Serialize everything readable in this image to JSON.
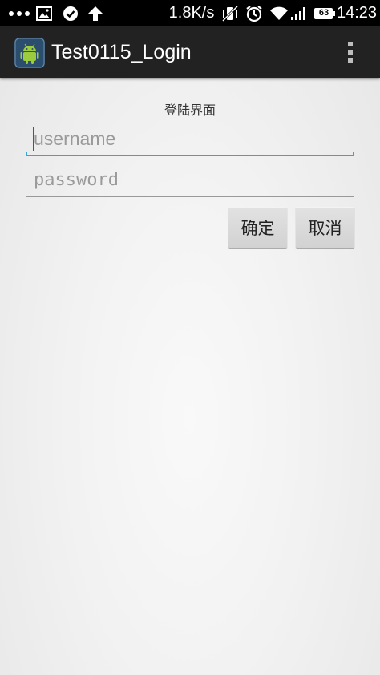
{
  "status_bar": {
    "network_speed": "1.8K/s",
    "battery_level": "63",
    "time": "14:23",
    "icons": [
      "more-dots-icon",
      "image-icon",
      "check-circle-icon",
      "upload-arrow-icon",
      "vibrate-icon",
      "alarm-icon",
      "wifi-icon",
      "signal-icon",
      "battery-icon"
    ]
  },
  "action_bar": {
    "app_title": "Test0115_Login",
    "app_icon": "android-icon",
    "menu_icon": "overflow-menu-icon"
  },
  "form": {
    "title": "登陆界面",
    "username_placeholder": "username",
    "username_value": "",
    "password_placeholder": "password",
    "password_value": "",
    "confirm_label": "确定",
    "cancel_label": "取消"
  },
  "colors": {
    "action_bar": "#222222",
    "focus_accent": "#33a6d8",
    "button_bg": "#d9d9d9"
  }
}
